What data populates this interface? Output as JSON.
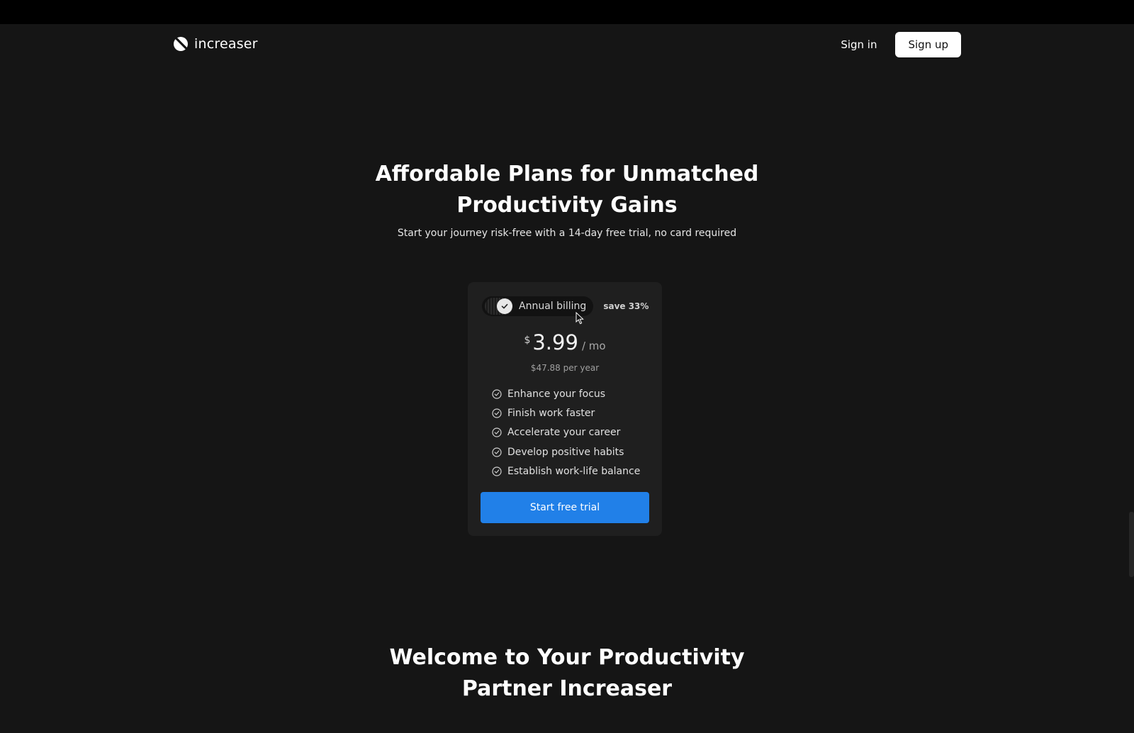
{
  "header": {
    "brand": "increaser",
    "sign_in": "Sign in",
    "sign_up": "Sign up"
  },
  "hero": {
    "title_line1": "Affordable Plans for Unmatched",
    "title_line2": "Productivity Gains",
    "subtitle": "Start your journey risk-free with a 14-day free trial, no card required"
  },
  "pricing": {
    "billing_toggle_label": "Annual billing",
    "billing_toggle_on": true,
    "save_badge": "save 33%",
    "currency": "$",
    "amount": "3.99",
    "period": "/ mo",
    "yearly": "$47.88 per year",
    "features": [
      "Enhance your focus",
      "Finish work faster",
      "Accelerate your career",
      "Develop positive habits",
      "Establish work-life balance"
    ],
    "cta": "Start free trial"
  },
  "welcome": {
    "title_line1": "Welcome to Your Productivity",
    "title_line2": "Partner Increaser"
  },
  "colors": {
    "background": "#151515",
    "card": "#1f1f1f",
    "accent": "#2180e8"
  },
  "icons": {
    "logo": "circle-slash-logo-icon",
    "toggle": "checkmark-icon",
    "feature": "check-circle-icon",
    "pointer": "mouse-cursor-icon"
  }
}
